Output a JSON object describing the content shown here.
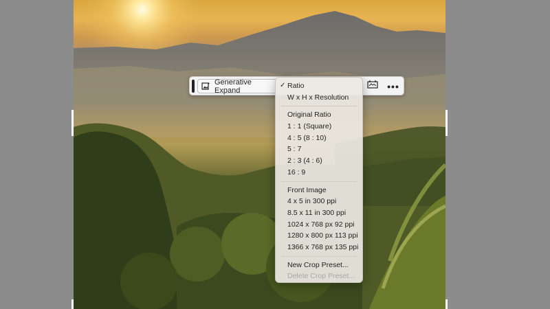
{
  "toolbar": {
    "generative_expand_label": "Generative Expand",
    "icons": [
      "generative-expand-icon",
      "crop-ratio-icon",
      "more-options-icon"
    ],
    "more_label": "•••"
  },
  "menu": {
    "group1": [
      {
        "label": "Ratio",
        "checked": true
      },
      {
        "label": "W x H x Resolution"
      }
    ],
    "group2": [
      {
        "label": "Original Ratio"
      },
      {
        "label": "1 : 1 (Square)"
      },
      {
        "label": "4 : 5 (8 : 10)"
      },
      {
        "label": "5 : 7"
      },
      {
        "label": "2 : 3 (4 : 6)"
      },
      {
        "label": "16 : 9"
      }
    ],
    "group3": [
      {
        "label": "Front Image"
      },
      {
        "label": "4 x 5 in 300 ppi"
      },
      {
        "label": "8.5 x 11 in 300 ppi"
      },
      {
        "label": "1024 x 768 px 92 ppi"
      },
      {
        "label": "1280 x 800 px 113 ppi"
      },
      {
        "label": "1366 x 768 px 135 ppi"
      }
    ],
    "group4": [
      {
        "label": "New Crop Preset..."
      },
      {
        "label": "Delete Crop Preset...",
        "disabled": true
      }
    ],
    "check_mark": "✓"
  },
  "colors": {
    "toolbar_bg": "#f3f3f3",
    "menu_bg": "#ece8e2",
    "workspace_bg": "#8c8c8c"
  }
}
